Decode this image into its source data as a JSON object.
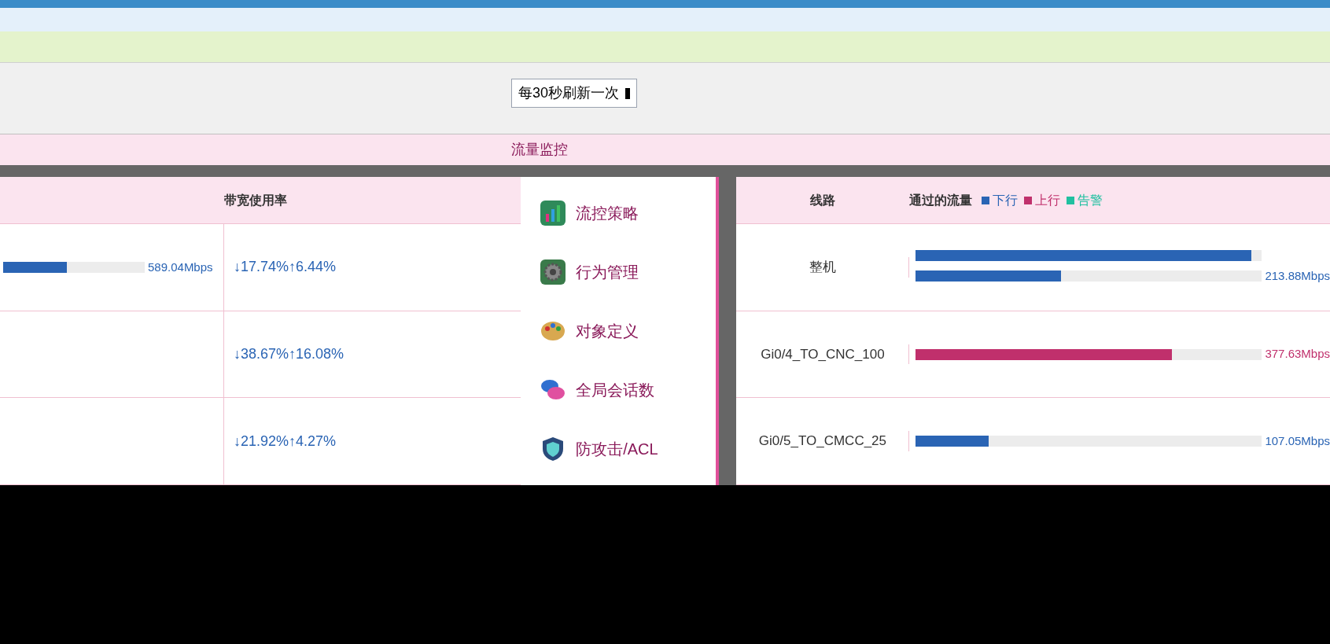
{
  "refresh": {
    "value": "每30秒刷新一次"
  },
  "section_title": "流量监控",
  "menu": [
    {
      "label": "流控策略",
      "kind": "chart"
    },
    {
      "label": "行为管理",
      "kind": "gear"
    },
    {
      "label": "对象定义",
      "kind": "palette"
    },
    {
      "label": "全局会话数",
      "kind": "chat"
    },
    {
      "label": "防攻击/ACL",
      "kind": "shield"
    }
  ],
  "left_table": {
    "columns": [
      "带宽使用率"
    ],
    "rows": [
      {
        "bars": [
          {
            "kind": "down",
            "level": 0.45,
            "reading": "589.04Mbps"
          }
        ],
        "usage": "↓17.74%↑6.44%"
      },
      {
        "bars": [],
        "usage": "↓38.67%↑16.08%"
      },
      {
        "bars": [],
        "usage": "↓21.92%↑4.27%"
      }
    ]
  },
  "right_table": {
    "columns": [
      "线路",
      "通过的流量"
    ],
    "legend": [
      {
        "label": "下行",
        "color": "#2a64b4"
      },
      {
        "label": "上行",
        "color": "#c0306c"
      },
      {
        "label": "告警",
        "color": "#20c0a0"
      }
    ],
    "rows": [
      {
        "line": "整机",
        "bars": [
          {
            "kind": "down",
            "level": 0.97
          },
          {
            "kind": "down",
            "level": 0.42,
            "reading": "213.88Mbps"
          }
        ]
      },
      {
        "line": "Gi0/4_TO_CNC_100",
        "bars": [
          {
            "kind": "up",
            "level": 0.74,
            "reading": "377.63Mbps"
          }
        ]
      },
      {
        "line": "Gi0/5_TO_CMCC_25",
        "bars": [
          {
            "kind": "down",
            "level": 0.21,
            "reading": "107.05Mbps"
          }
        ]
      }
    ]
  }
}
